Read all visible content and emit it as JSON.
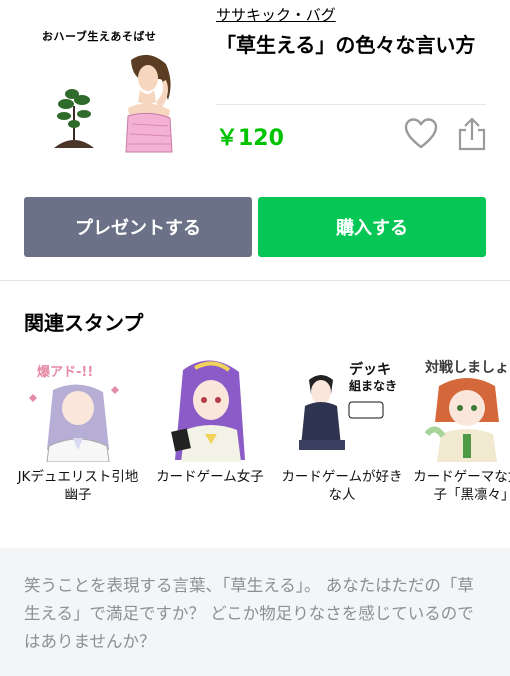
{
  "product": {
    "thumb_caption": "おハーブ生えあそばせ",
    "author": "ササキック・バグ",
    "title": "「草生える」の色々な言い方",
    "price": "￥120"
  },
  "actions": {
    "gift_label": "プレゼントする",
    "buy_label": "購入する"
  },
  "related": {
    "heading": "関連スタンプ",
    "items": [
      {
        "label": "JKデュエリスト引地幽子"
      },
      {
        "label": "カードゲーム女子"
      },
      {
        "label": "カードゲームが好きな人",
        "art_text": [
          "デッキ",
          "組まなきゃ"
        ]
      },
      {
        "label": "カードゲーマな女の子「黒凛々」"
      }
    ]
  },
  "description": "笑うことを表現する言葉、「草生える」。 あなたはただの「草生える」で満足ですか？ どこか物足りなさを感じているのではありませんか？",
  "colors": {
    "price": "#00c300",
    "buy_button": "#06c755",
    "gift_button": "#6b7287",
    "description_bg": "#f4f5f7"
  },
  "icons": {
    "favorite": "heart-outline-icon",
    "share": "share-icon"
  }
}
